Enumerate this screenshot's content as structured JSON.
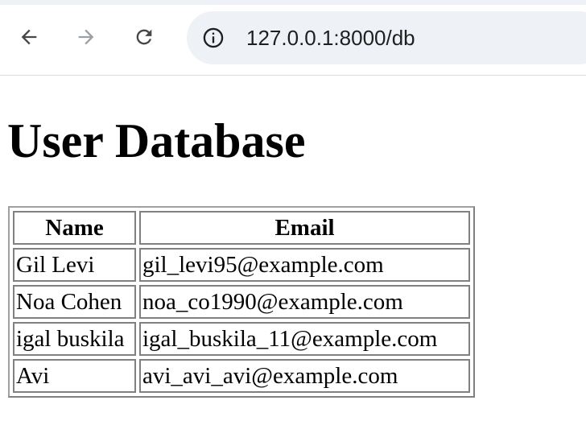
{
  "browser": {
    "back_icon": "arrow-left-icon",
    "forward_icon": "arrow-right-icon",
    "reload_icon": "reload-icon",
    "site_info_icon": "info-icon",
    "url": "127.0.0.1:8000/db"
  },
  "page": {
    "title": "User Database",
    "table": {
      "headers": {
        "name": "Name",
        "email": "Email"
      },
      "rows": [
        {
          "name": "Gil Levi",
          "email": "gil_levi95@example.com"
        },
        {
          "name": "Noa Cohen",
          "email": "noa_co1990@example.com"
        },
        {
          "name": "igal buskila",
          "email": "igal_buskila_11@example.com"
        },
        {
          "name": "Avi",
          "email": "avi_avi_avi@example.com"
        }
      ]
    }
  }
}
